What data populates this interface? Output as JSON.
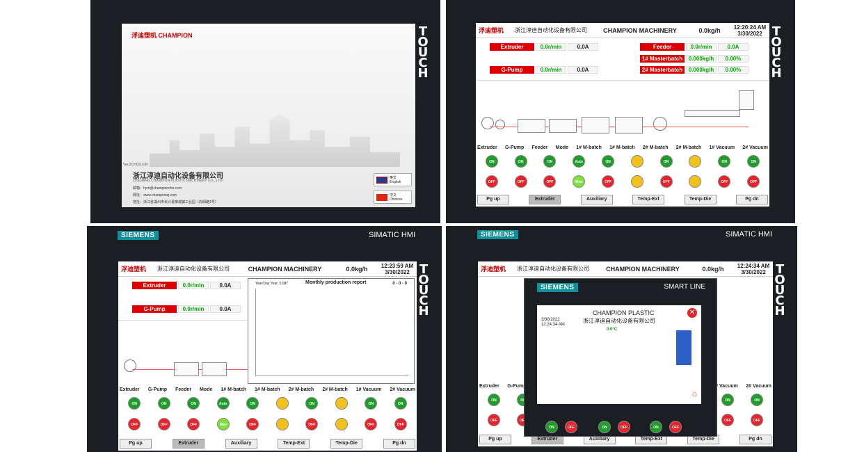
{
  "touch_label": "TOUCH",
  "panel1": {
    "logo": "浮迪塑机 CHAMPION",
    "version": "Ver.ZCH01110B",
    "company_cn": "浙江淳迪自动化设备有限公司",
    "company_en": "ZHEJIANG CHAMPION PLASTIC MACHINERY CO., LTD.",
    "email": "邮箱：hym@championchn.com",
    "web": "网址：www.championzj.com",
    "address": "地址：浙江省湖州市长兴县雉城镇工业园（向阳路1号）",
    "lang_en_cn": "英文",
    "lang_en": "English",
    "lang_cn_cn": "中文",
    "lang_cn": "Chinese"
  },
  "panel2": {
    "header": {
      "logo": "浮迪塑机",
      "company": "浙江淳迪自动化设备有限公司",
      "title": "CHAMPION MACHINERY",
      "rate": "0.0kg/h",
      "time": "12:20:24 AM",
      "date": "3/30/2022"
    },
    "extruder": {
      "label": "Extruder",
      "speed": "0.0r/min",
      "current": "0.0A"
    },
    "gpump": {
      "label": "G-Pump",
      "speed": "0.0r/min",
      "current": "0.0A"
    },
    "feeder": {
      "label": "Feeder",
      "speed": "0.0r/min",
      "current": "0.0A"
    },
    "mb1": {
      "label": "1# Masterbatch",
      "rate": "0.000kg/h",
      "pct": "0.00%"
    },
    "mb2": {
      "label": "2# Masterbatch",
      "rate": "0.000kg/h",
      "pct": "0.00%"
    }
  },
  "panel3": {
    "siemens": "SIEMENS",
    "simatic": "SIMATIC HMI",
    "header": {
      "logo": "浮迪塑机",
      "company": "浙江淳迪自动化设备有限公司",
      "title": "CHAMPION MACHINERY",
      "rate": "0.0kg/h",
      "time": "12:23:59 AM",
      "date": "3/30/2022"
    },
    "extruder": {
      "label": "Extruder",
      "speed": "0.0r/min",
      "current": "0.0A"
    },
    "gpump": {
      "label": "G-Pump",
      "speed": "0.0r/min",
      "current": "0.0A"
    },
    "report": {
      "title": "Monthly production report",
      "left": "Year/Day Year: 0.087",
      "right": "0 - 0 - 0"
    }
  },
  "panel4": {
    "siemens": "SIEMENS",
    "simatic": "SIMATIC HMI",
    "header": {
      "logo": "浮迪塑机",
      "company": "浙江淳迪自动化设备有限公司",
      "title": "CHAMPION MACHINERY",
      "rate": "0.0kg/h",
      "time": "12:24:34 AM",
      "date": "3/30/2022"
    },
    "popup": {
      "brand": "SIEMENS",
      "line": "SMART LINE",
      "title": "CHAMPION PLASTIC",
      "subtitle": "浙江淳迪自动化设备有限公司",
      "date": "3/30/2022",
      "time": "12:24:34 AM",
      "temp": "0.0°C"
    }
  },
  "status_labels": [
    "Extruder",
    "G-Pump",
    "Feeder",
    "Mode",
    "1# M-batch",
    "1# M-batch",
    "2# M-batch",
    "2# M-batch",
    "1# Vacuum",
    "2# Vacuum"
  ],
  "on_row": [
    "ON",
    "ON",
    "ON",
    "Auto",
    "ON",
    "",
    "ON",
    "",
    "ON",
    "ON"
  ],
  "off_row": [
    "OFF",
    "OFF",
    "OFF",
    "Man",
    "OFF",
    "",
    "OFF",
    "",
    "OFF",
    "OFF"
  ],
  "nav": [
    "Pg up",
    "Extruder",
    "Auxiliary",
    "Temp-Ext",
    "Temp-Die",
    "Pg dn"
  ],
  "colors": {
    "accent": "#d00000",
    "green": "#1f9c2a",
    "siemens": "#0f8f9c"
  }
}
